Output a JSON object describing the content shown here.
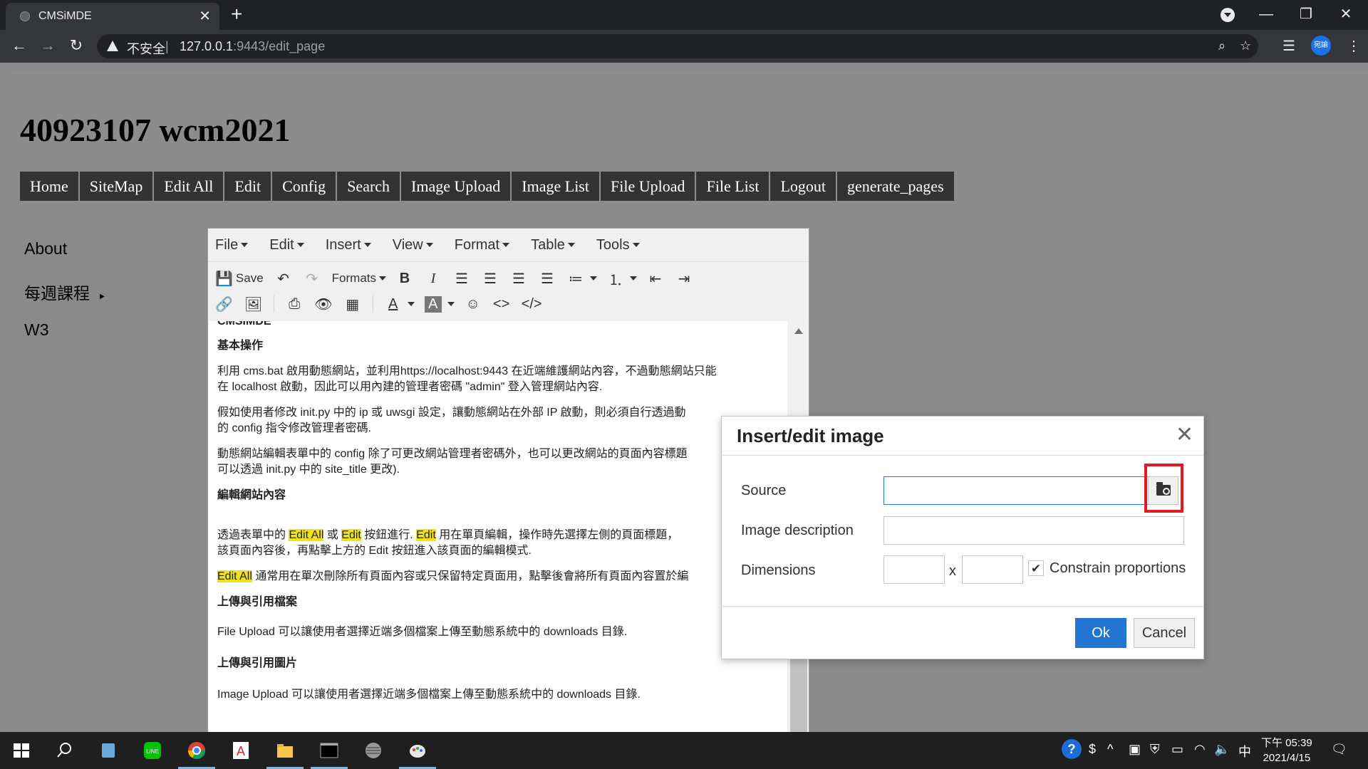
{
  "browser": {
    "tab_title": "CMSiMDE",
    "tab_close": "✕",
    "new_tab": "+",
    "insecure_label": "不安全",
    "url_host": "127.0.0.1",
    "url_rest": ":9443/edit_page",
    "profile_label": "宛諭",
    "window_controls": {
      "minimize": "—",
      "restore": "❐",
      "close": "✕"
    }
  },
  "site": {
    "title": "40923107 wcm2021",
    "menu": [
      "Home",
      "SiteMap",
      "Edit All",
      "Edit",
      "Config",
      "Search",
      "Image Upload",
      "Image List",
      "File Upload",
      "File List",
      "Logout",
      "generate_pages"
    ],
    "sidebar": [
      {
        "label": "About",
        "has_children": false
      },
      {
        "label": "每週課程",
        "has_children": true,
        "arrow": "▸"
      },
      {
        "label": "W3",
        "has_children": false
      }
    ]
  },
  "editor": {
    "menubar": [
      "File",
      "Edit",
      "Insert",
      "View",
      "Format",
      "Table",
      "Tools"
    ],
    "toolbar_row1": {
      "save": "Save",
      "formats": "Formats"
    },
    "content": {
      "clipped_heading": "CMSIMDE",
      "h_basic": "基本操作",
      "p1_line1": "利用 cms.bat 啟用動態網站，並利用https://localhost:9443 在近端維護網站內容，不過動態網站只能",
      "p1_line2": "在 localhost 啟動，因此可以用內建的管理者密碼 \"admin\" 登入管理網站內容.",
      "p2_line1": "假如使用者修改 init.py 中的 ip 或 uwsgi 設定，讓動態網站在外部 IP 啟動，則必須自行透過動",
      "p2_line2": "的 config 指令修改管理者密碼.",
      "p3_line1": "動態網站編輯表單中的 config 除了可更改網站管理者密碼外，也可以更改網站的頁面內容標題",
      "p3_line2": "可以透過 init.py 中的 site_title 更改).",
      "h_edit": "編輯網站內容",
      "p4_a": "透過表單中的 ",
      "p4_hl1": "Edit All",
      "p4_b": " 或 ",
      "p4_hl2": "Edit",
      "p4_c": " 按鈕進行. ",
      "p4_hl3": "Edit",
      "p4_d": " 用在單頁編輯，操作時先選擇左側的頁面標題，",
      "p4_line2": "該頁面內容後，再點擊上方的 Edit 按鈕進入該頁面的編輯模式.",
      "p5_hl": "Edit All",
      "p5_rest": " 通常用在單次刪除所有頁面內容或只保留特定頁面用，點擊後會將所有頁面內容置於編",
      "h_upload": "上傳與引用檔案",
      "p6": "File Upload 可以讓使用者選擇近端多個檔案上傳至動態系統中的 downloads 目錄.",
      "h_image": "上傳與引用圖片",
      "p7": "Image Upload 可以讓使用者選擇近端多個檔案上傳至動態系統中的 downloads 目錄."
    }
  },
  "dialog": {
    "title": "Insert/edit image",
    "close": "✕",
    "source_label": "Source",
    "source_value": "",
    "description_label": "Image description",
    "description_value": "",
    "dimensions_label": "Dimensions",
    "width_value": "",
    "height_value": "",
    "dim_separator": "x",
    "constrain_label": "Constrain proportions",
    "constrain_checked": true,
    "ok_label": "Ok",
    "cancel_label": "Cancel",
    "highlight_color": "#e01b24",
    "ok_color": "#2276d2"
  },
  "taskbar": {
    "time_period": "下午 05:39",
    "date": "2021/4/15",
    "ime": "中"
  }
}
